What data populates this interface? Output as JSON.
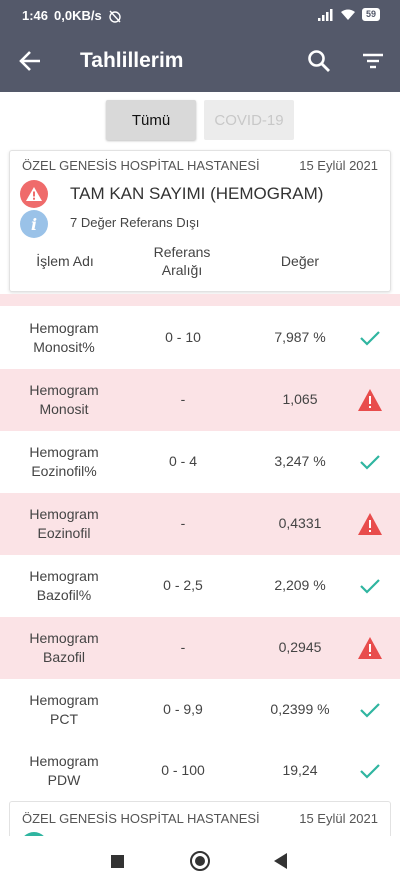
{
  "status_bar": {
    "time": "1:46",
    "speed": "0,0KB/s",
    "battery": "59"
  },
  "app_bar": {
    "title": "Tahlillerim"
  },
  "tabs": [
    {
      "label": "Tümü",
      "active": true
    },
    {
      "label": "COVID-19",
      "active": false
    }
  ],
  "card": {
    "hospital": "ÖZEL GENESİS HOSPİTAL HASTANESİ",
    "date": "15 Eylül 2021",
    "test_title": "TAM KAN SAYIMI (HEMOGRAM)",
    "out_of_range": "7 Değer Referans Dışı",
    "info_glyph": "i",
    "columns": {
      "name": "İşlem Adı",
      "ref_line1": "Referans",
      "ref_line2": "Aralığı",
      "value": "Değer"
    }
  },
  "rows": [
    {
      "name1": "Hemogram",
      "name2": "Monosit%",
      "ref": "0 - 10",
      "value": "7,987 %",
      "status": "normal"
    },
    {
      "name1": "Hemogram",
      "name2": "Monosit",
      "ref": "-",
      "value": "1,065",
      "status": "abnormal"
    },
    {
      "name1": "Hemogram",
      "name2": "Eozinofil%",
      "ref": "0 - 4",
      "value": "3,247 %",
      "status": "normal"
    },
    {
      "name1": "Hemogram",
      "name2": "Eozinofil",
      "ref": "-",
      "value": "0,4331",
      "status": "abnormal"
    },
    {
      "name1": "Hemogram",
      "name2": "Bazofil%",
      "ref": "0 - 2,5",
      "value": "2,209 %",
      "status": "normal"
    },
    {
      "name1": "Hemogram",
      "name2": "Bazofil",
      "ref": "-",
      "value": "0,2945",
      "status": "abnormal"
    },
    {
      "name1": "Hemogram",
      "name2": "PCT",
      "ref": "0 - 9,9",
      "value": "0,2399 %",
      "status": "normal"
    },
    {
      "name1": "Hemogram",
      "name2": "PDW",
      "ref": "0 - 100",
      "value": "19,24",
      "status": "normal"
    }
  ],
  "next_card": {
    "hospital": "ÖZEL GENESİS HOSPİTAL HASTANESİ",
    "date": "15 Eylül 2021"
  },
  "colors": {
    "header": "#54596a",
    "abnormal_row": "#fbe3e6",
    "warning": "#e84c4c",
    "check": "#2fb5a0",
    "info": "#9ac2e8"
  }
}
